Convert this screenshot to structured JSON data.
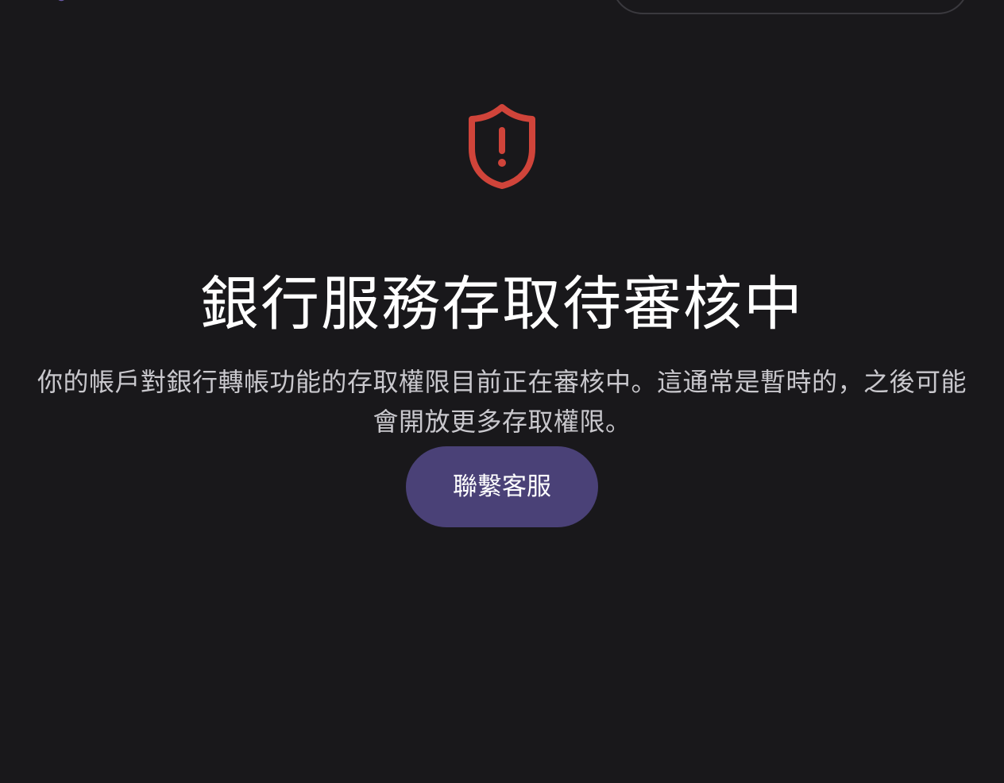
{
  "status": {
    "icon": "shield-alert-icon",
    "icon_color": "#d0443a",
    "title": "銀行服務存取待審核中",
    "message": "你的帳戶對銀行轉帳功能的存取權限目前正在審核中。這通常是暫時的，之後可能會開放更多存取權限。"
  },
  "actions": {
    "contact_support_label": "聯繫客服"
  },
  "colors": {
    "background": "#19181b",
    "button": "#4a4177",
    "secondary_text": "#c9c8cd",
    "logo_accent": "#6b5aa8"
  }
}
